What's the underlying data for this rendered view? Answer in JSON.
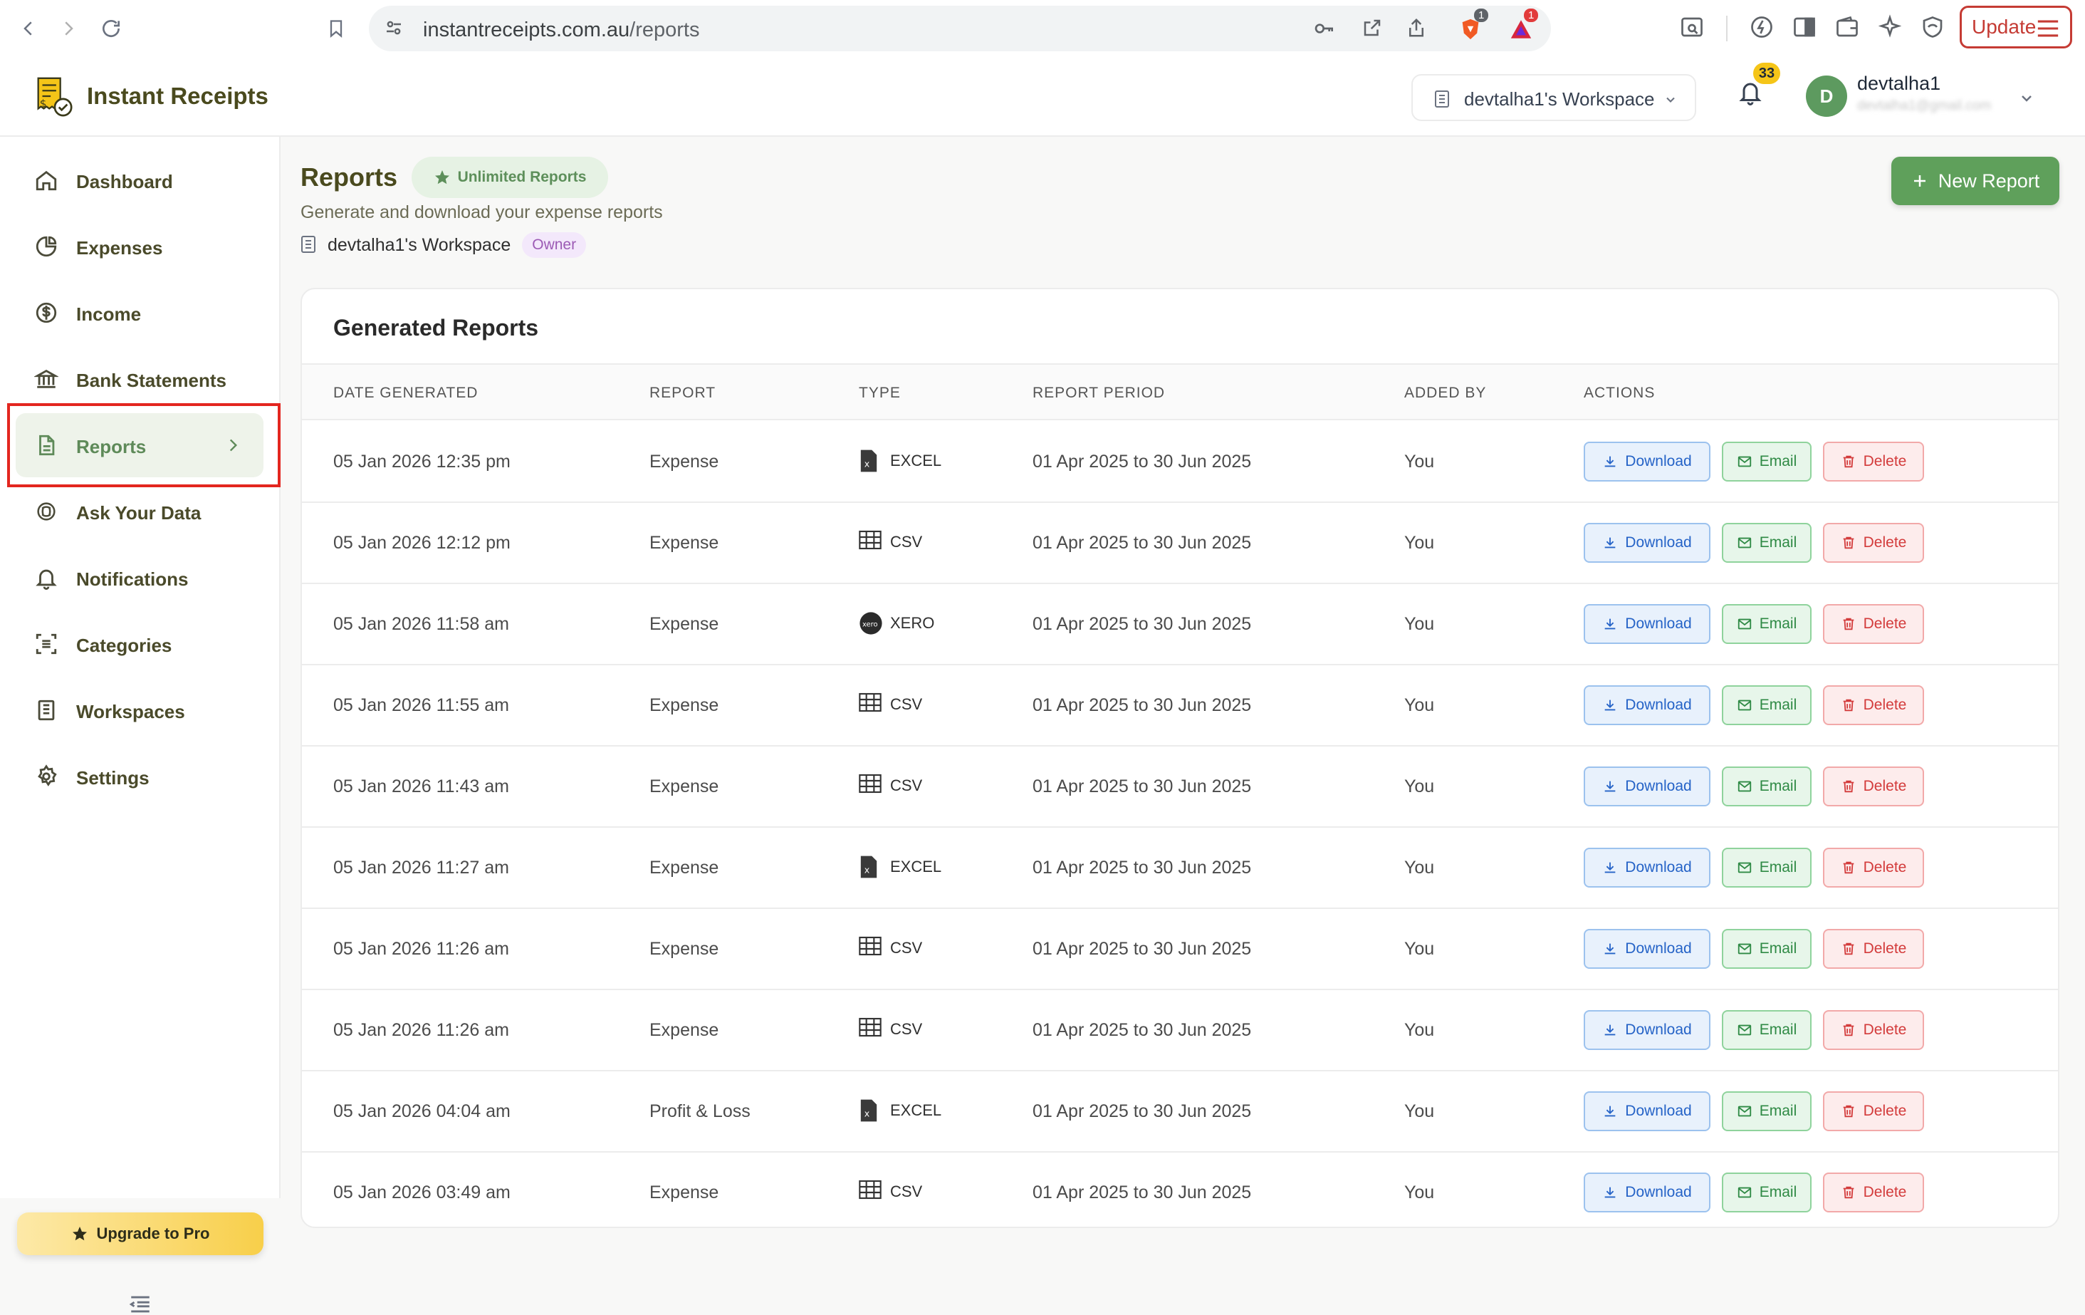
{
  "browser": {
    "url_host": "instantreceipts.com.au",
    "url_path": "/reports",
    "update_label": "Update",
    "ext_badge_1": "1",
    "ext_badge_2": "1"
  },
  "header": {
    "brand": "Instant Receipts",
    "workspace": "devtalha1's Workspace",
    "notification_count": "33",
    "avatar_initial": "D",
    "user_name": "devtalha1",
    "user_email": "devtalha1@gmail.com"
  },
  "sidebar": {
    "items": [
      {
        "label": "Dashboard",
        "icon": "home-icon"
      },
      {
        "label": "Expenses",
        "icon": "pie-chart-icon"
      },
      {
        "label": "Income",
        "icon": "dollar-circle-icon"
      },
      {
        "label": "Bank Statements",
        "icon": "bank-icon"
      },
      {
        "label": "Reports",
        "icon": "file-text-icon",
        "active": true
      },
      {
        "label": "Ask Your Data",
        "icon": "ai-icon"
      },
      {
        "label": "Notifications",
        "icon": "bell-icon"
      },
      {
        "label": "Categories",
        "icon": "scan-list-icon"
      },
      {
        "label": "Workspaces",
        "icon": "building-icon"
      },
      {
        "label": "Settings",
        "icon": "gear-icon"
      }
    ],
    "upgrade_label": "Upgrade to Pro"
  },
  "page": {
    "title": "Reports",
    "plan_badge": "Unlimited Reports",
    "subtitle": "Generate and download your expense reports",
    "workspace": "devtalha1's Workspace",
    "role_badge": "Owner",
    "new_report_label": "New Report"
  },
  "table": {
    "title": "Generated Reports",
    "columns": [
      "DATE GENERATED",
      "REPORT",
      "TYPE",
      "REPORT PERIOD",
      "ADDED BY",
      "ACTIONS"
    ],
    "actions": {
      "download": "Download",
      "email": "Email",
      "delete": "Delete"
    },
    "rows": [
      {
        "date": "05 Jan 2026 12:35 pm",
        "report": "Expense",
        "type": "EXCEL",
        "type_icon": "excel-icon",
        "period": "01 Apr 2025 to 30 Jun 2025",
        "added_by": "You"
      },
      {
        "date": "05 Jan 2026 12:12 pm",
        "report": "Expense",
        "type": "CSV",
        "type_icon": "table-icon",
        "period": "01 Apr 2025 to 30 Jun 2025",
        "added_by": "You"
      },
      {
        "date": "05 Jan 2026 11:58 am",
        "report": "Expense",
        "type": "XERO",
        "type_icon": "xero-icon",
        "period": "01 Apr 2025 to 30 Jun 2025",
        "added_by": "You"
      },
      {
        "date": "05 Jan 2026 11:55 am",
        "report": "Expense",
        "type": "CSV",
        "type_icon": "table-icon",
        "period": "01 Apr 2025 to 30 Jun 2025",
        "added_by": "You"
      },
      {
        "date": "05 Jan 2026 11:43 am",
        "report": "Expense",
        "type": "CSV",
        "type_icon": "table-icon",
        "period": "01 Apr 2025 to 30 Jun 2025",
        "added_by": "You"
      },
      {
        "date": "05 Jan 2026 11:27 am",
        "report": "Expense",
        "type": "EXCEL",
        "type_icon": "excel-icon",
        "period": "01 Apr 2025 to 30 Jun 2025",
        "added_by": "You"
      },
      {
        "date": "05 Jan 2026 11:26 am",
        "report": "Expense",
        "type": "CSV",
        "type_icon": "table-icon",
        "period": "01 Apr 2025 to 30 Jun 2025",
        "added_by": "You"
      },
      {
        "date": "05 Jan 2026 11:26 am",
        "report": "Expense",
        "type": "CSV",
        "type_icon": "table-icon",
        "period": "01 Apr 2025 to 30 Jun 2025",
        "added_by": "You"
      },
      {
        "date": "05 Jan 2026 04:04 am",
        "report": "Profit & Loss",
        "type": "EXCEL",
        "type_icon": "excel-icon",
        "period": "01 Apr 2025 to 30 Jun 2025",
        "added_by": "You"
      },
      {
        "date": "05 Jan 2026 03:49 am",
        "report": "Expense",
        "type": "CSV",
        "type_icon": "table-icon",
        "period": "01 Apr 2025 to 30 Jun 2025",
        "added_by": "You"
      }
    ]
  },
  "colors": {
    "brand_green": "#5fa05b",
    "sidebar_active_bg": "#eef3ea",
    "highlight_red": "#e3261f",
    "upgrade_gold": "#f8cf4a"
  }
}
